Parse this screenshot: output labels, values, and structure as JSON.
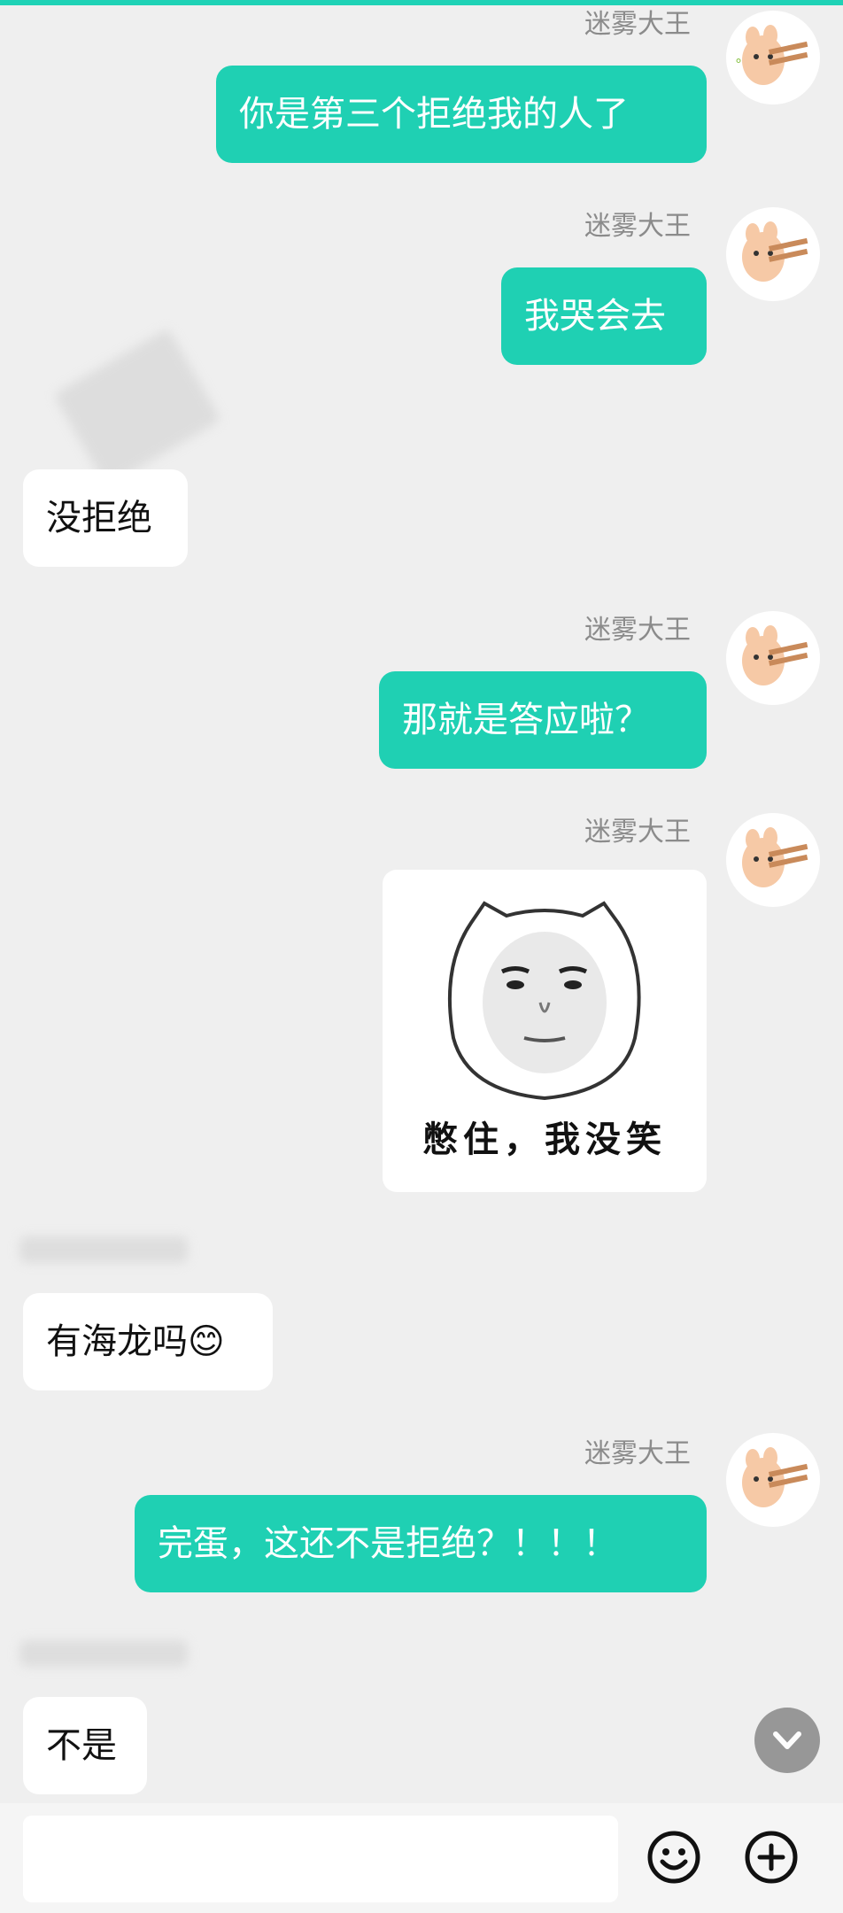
{
  "messages": [
    {
      "side": "me",
      "sender": "迷雾大王",
      "text": "你是第三个拒绝我的人了"
    },
    {
      "side": "me",
      "sender": "迷雾大王",
      "text": "我哭会去"
    },
    {
      "side": "other",
      "sender": "",
      "text": "没拒绝"
    },
    {
      "side": "me",
      "sender": "迷雾大王",
      "text": "那就是答应啦？"
    },
    {
      "side": "me",
      "sender": "迷雾大王",
      "sticker_caption": "憋住，我没笑"
    },
    {
      "side": "other",
      "sender": "",
      "text": "有海龙吗😊"
    },
    {
      "side": "me",
      "sender": "迷雾大王",
      "text": "完蛋，这还不是拒绝？！！！"
    },
    {
      "side": "other",
      "sender": "",
      "text": "不是"
    }
  ],
  "input": {
    "value": "",
    "placeholder": ""
  },
  "icons": {
    "emoji": "smiley-icon",
    "plus": "plus-circle-icon",
    "scroll": "chevron-down-icon"
  },
  "colors": {
    "accent": "#1fd0b3",
    "background": "#efefef"
  }
}
